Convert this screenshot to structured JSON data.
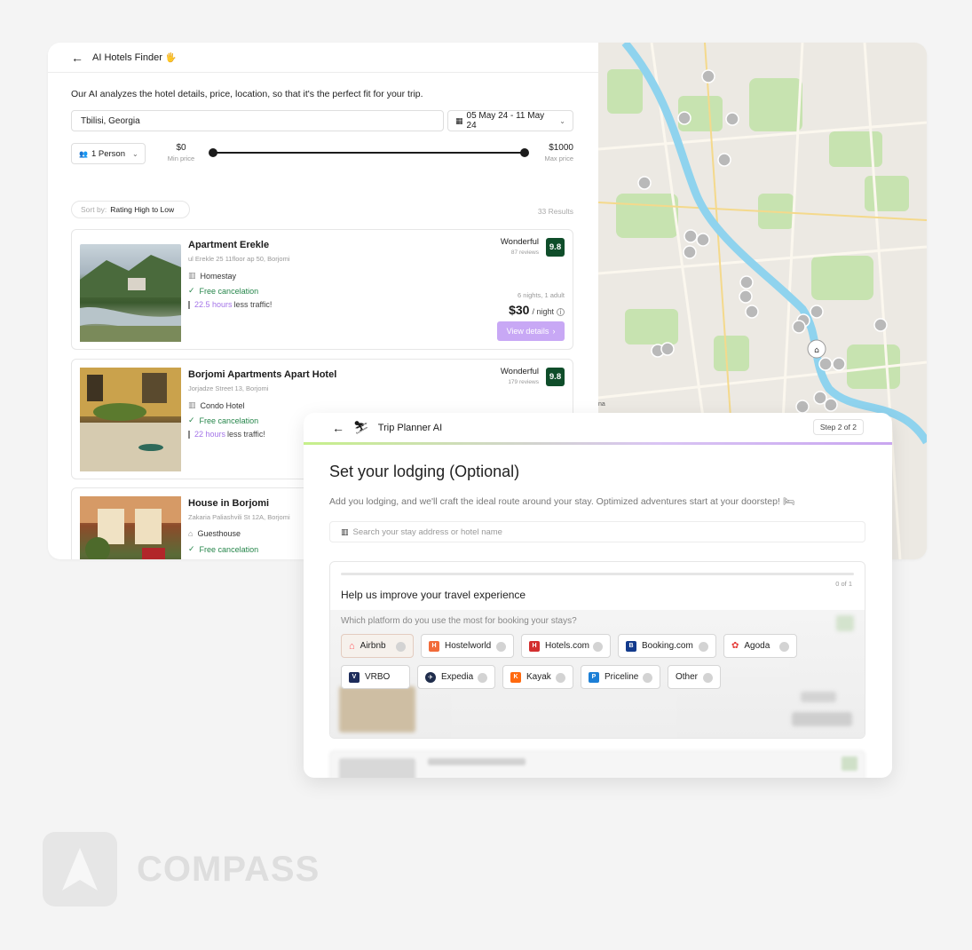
{
  "finder": {
    "title": "AI Hotels Finder",
    "title_emoji": "🖐",
    "intro": "Our AI analyzes the hotel details, price, location, so that it's the perfect fit for your trip.",
    "location_value": "Tbilisi, Georgia",
    "dates": "05 May 24 - 11 May 24",
    "persons": "1 Person",
    "price_min_value": "$0",
    "price_min_label": "Min price",
    "price_max_value": "$1000",
    "price_max_label": "Max price",
    "sort_label": "Sort by:",
    "sort_value": "Rating High to Low",
    "results": "33 Results",
    "hotels": [
      {
        "name": "Apartment Erekle",
        "address": "ul Erekle 25 11floor ap 50, Borjomi",
        "type": "Homestay",
        "cancel": "Free cancelation",
        "traffic_hours": "22.5 hours",
        "traffic_text": "less traffic!",
        "rating_word": "Wonderful",
        "reviews": "87 reviews",
        "score": "9.8",
        "stay": "6 nights, 1 adult",
        "price": "$30",
        "price_unit": "/ night",
        "button": "View details"
      },
      {
        "name": "Borjomi Apartments Apart Hotel",
        "address": "Jorjadze Street 13, Borjomi",
        "type": "Condo Hotel",
        "cancel": "Free cancelation",
        "traffic_hours": "22 hours",
        "traffic_text": "less traffic!",
        "rating_word": "Wonderful",
        "reviews": "179 reviews",
        "score": "9.8"
      },
      {
        "name": "House in Borjomi",
        "address": "Zakaria Paliashvili St 12A, Borjomi",
        "type": "Guesthouse",
        "cancel": "Free cancelation"
      }
    ],
    "map_credit": "na"
  },
  "planner": {
    "title": "Trip Planner AI",
    "step": "Step 2 of 2",
    "heading": "Set your lodging (Optional)",
    "description": "Add you lodging, and we'll craft the ideal route around your stay. Optimized adventures start at your doorstep! 🛏",
    "search_placeholder": "Search your stay address or hotel name",
    "survey": {
      "count": "0 of 1",
      "title": "Help us improve your travel experience",
      "question": "Which platform do you use the most for booking your stays?",
      "options": [
        "Airbnb",
        "Hostelworld",
        "Hotels.com",
        "Booking.com",
        "Agoda",
        "VRBO",
        "Expedia",
        "Kayak",
        "Priceline",
        "Other"
      ]
    }
  },
  "brand": {
    "name": "COMPASS"
  },
  "colors": {
    "accent_purple": "#c8a8f5",
    "rating_green": "#0f4d2a",
    "cancel_green": "#26864b",
    "river": "#8fd3ee",
    "park": "#bfe0a9"
  }
}
